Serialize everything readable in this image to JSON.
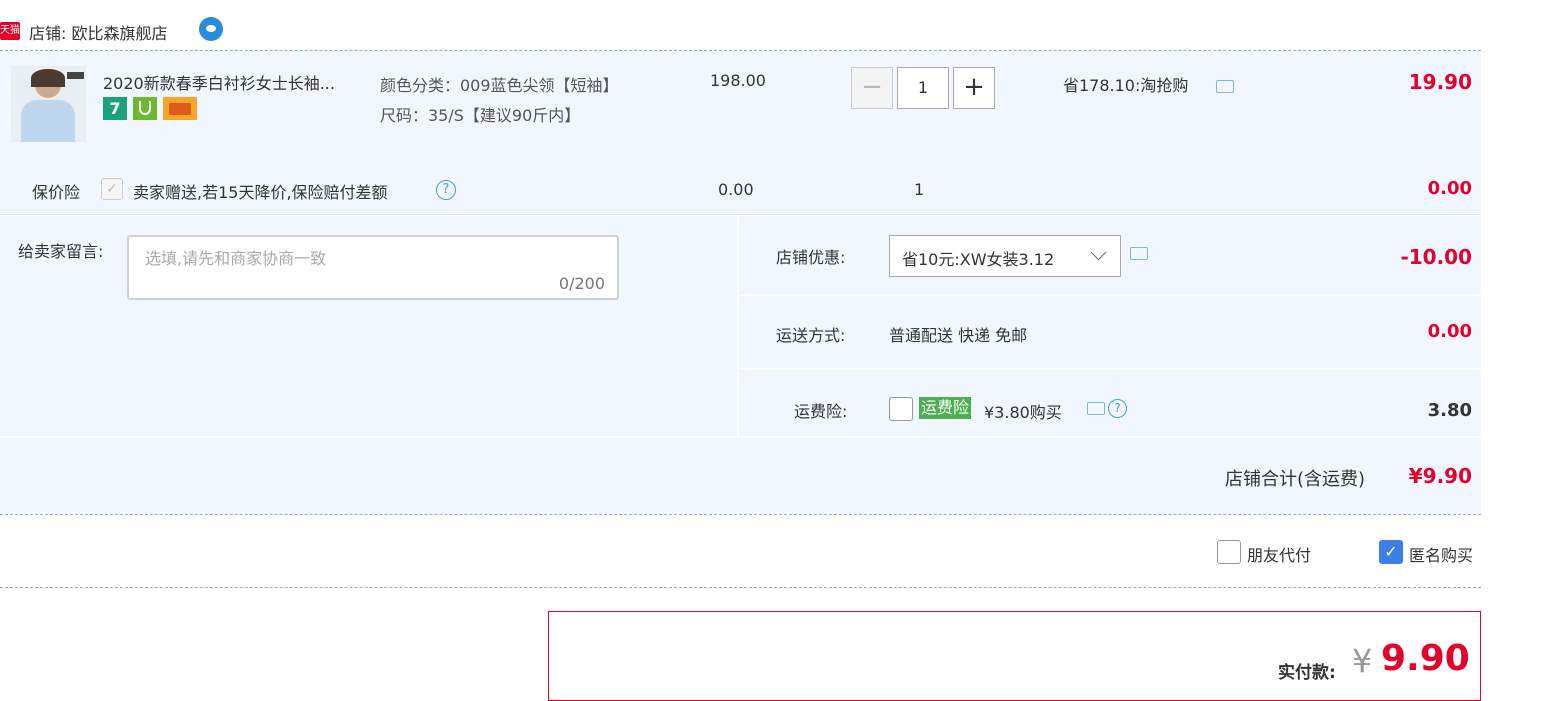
{
  "shop": {
    "badge": "天猫",
    "label": "店铺: 欧比森旗舰店"
  },
  "item": {
    "title": "2020新款春季白衬衫女士长袖...",
    "sku_color": "颜色分类：009蓝色尖领【短袖】",
    "sku_size": "尺码：35/S【建议90斤内】",
    "unit_price": "198.00",
    "quantity": "1",
    "discount_text": "省178.10:淘抢购",
    "subtotal": "19.90",
    "service_icons": [
      "7-day-return-icon",
      "shield-icon",
      "card-icon"
    ]
  },
  "insurance": {
    "label": "保价险",
    "desc": "卖家赠送,若15天降价,保险赔付差额",
    "price": "0.00",
    "qty": "1",
    "total": "0.00"
  },
  "message": {
    "label": "给卖家留言:",
    "placeholder": "选填,请先和商家协商一致",
    "counter": "0/200"
  },
  "shop_discount": {
    "label": "店铺优惠:",
    "selected": "省10元:XW女装3.12",
    "amount": "-10.00"
  },
  "shipping": {
    "label": "运送方式:",
    "value": "普通配送 快递 免邮",
    "amount": "0.00"
  },
  "freight_insurance": {
    "label": "运费险:",
    "tag": "运费险",
    "price_text": "¥3.80购买",
    "amount": "3.80"
  },
  "shop_total": {
    "label": "店铺合计(含运费)",
    "amount": "¥9.90"
  },
  "options": {
    "friend_pay": "朋友代付",
    "anonymous": "匿名购买"
  },
  "pay": {
    "label": "实付款:",
    "currency": "¥",
    "amount": "9.90"
  },
  "colors": {
    "accent_red": "#e4002b",
    "row_bg": "#f2f7ff",
    "checkbox_blue": "#3d7fe8",
    "tag_green": "#4caf50"
  }
}
